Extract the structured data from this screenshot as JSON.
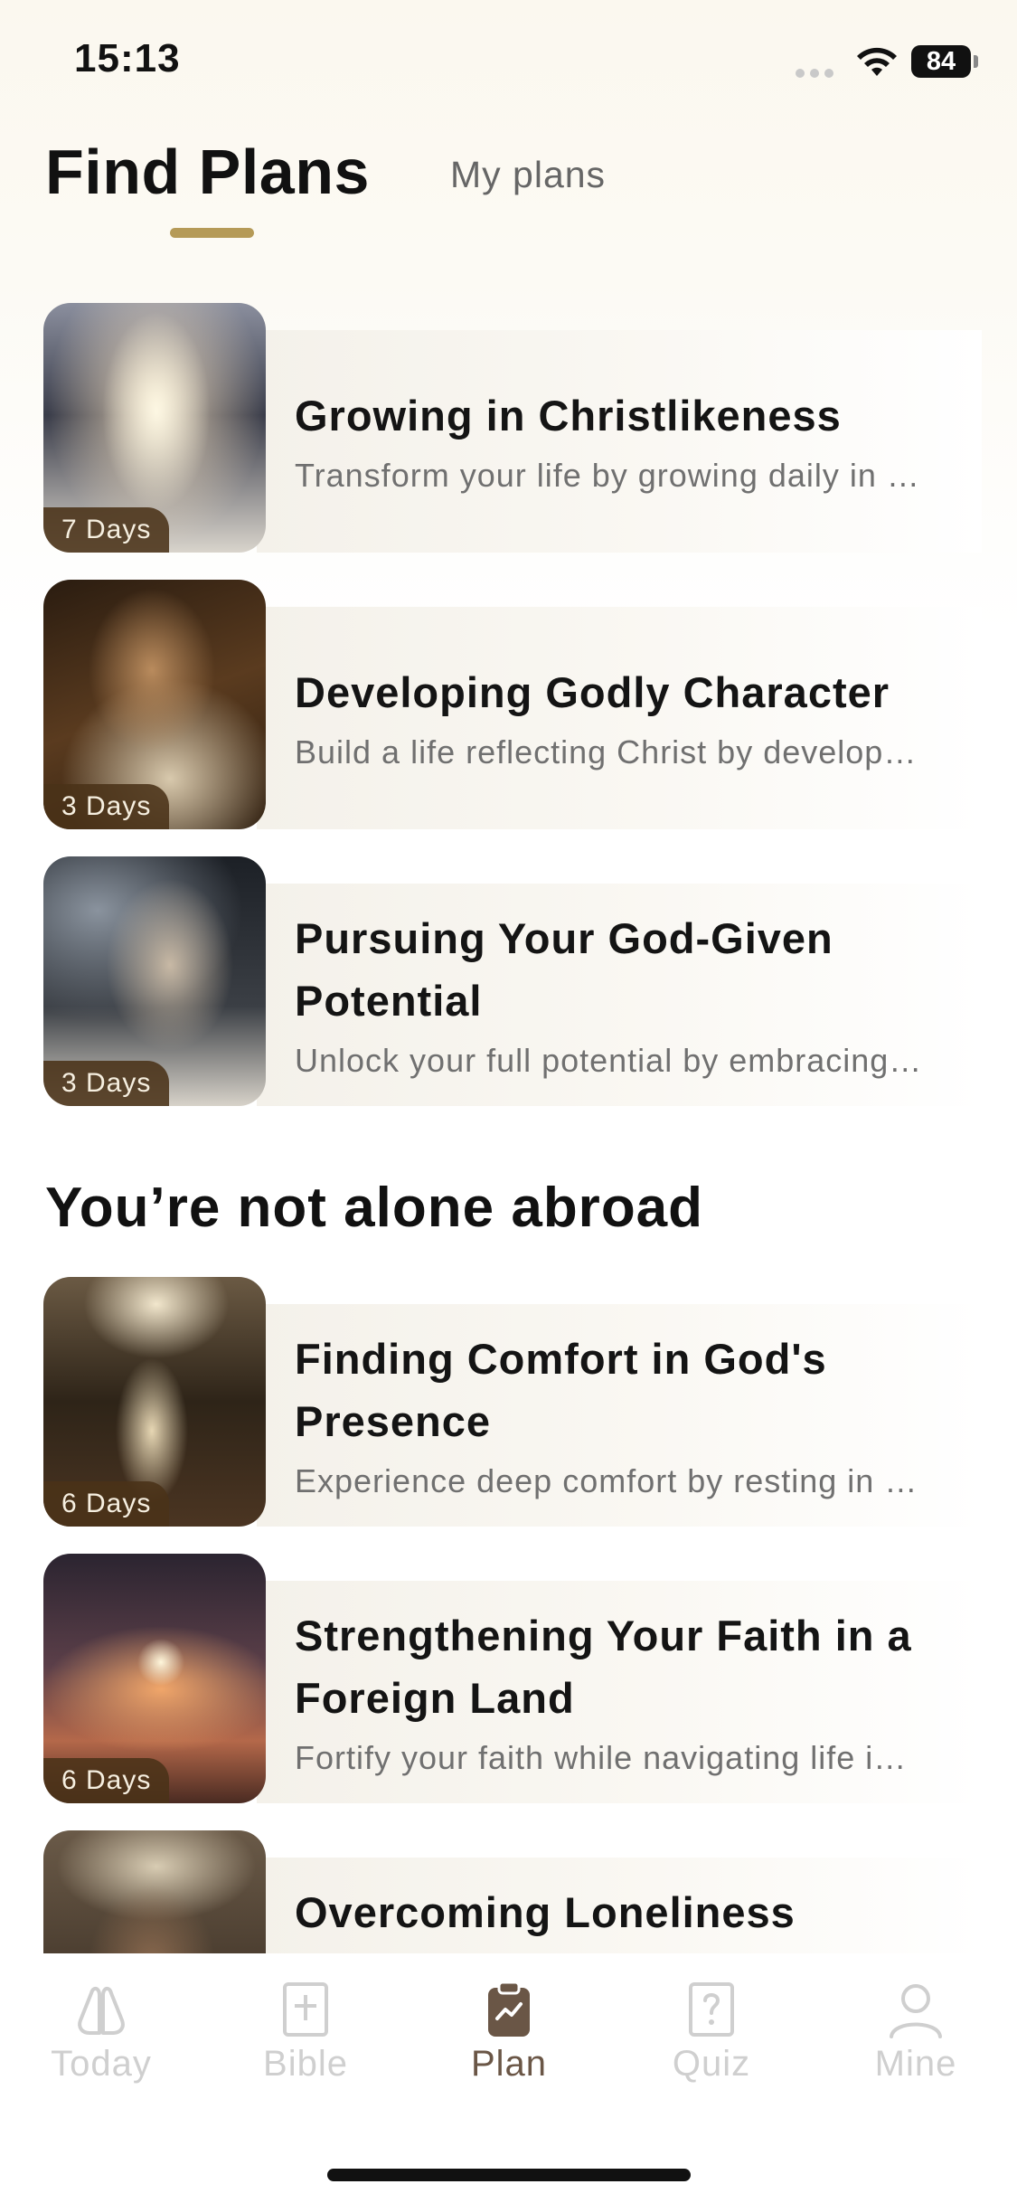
{
  "status_bar": {
    "time": "15:13",
    "battery": "84"
  },
  "header": {
    "active_tab": "Find Plans",
    "other_tab": "My plans"
  },
  "plans": [
    {
      "title": "Growing in Christlikeness",
      "description": "Transform your life by growing daily in …",
      "days": "7 Days"
    },
    {
      "title": "Developing Godly Character",
      "description": "Build a life reflecting Christ by develop…",
      "days": "3 Days"
    },
    {
      "title": "Pursuing Your God-Given Potential",
      "description": "Unlock your full potential by embracing…",
      "days": "3 Days"
    }
  ],
  "section": {
    "title": "You’re not alone abroad",
    "plans": [
      {
        "title": "Finding Comfort in God's Presence",
        "description": "Experience deep comfort by resting in …",
        "days": "6 Days"
      },
      {
        "title": "Strengthening Your Faith in a Foreign Land",
        "description": "Fortify your faith while navigating life i…",
        "days": "6 Days"
      },
      {
        "title": "Overcoming Loneliness"
      }
    ]
  },
  "nav": [
    {
      "label": "Today",
      "icon": "praying-hands-icon"
    },
    {
      "label": "Bible",
      "icon": "bible-icon"
    },
    {
      "label": "Plan",
      "icon": "plan-clipboard-icon",
      "active": true
    },
    {
      "label": "Quiz",
      "icon": "quiz-icon"
    },
    {
      "label": "Mine",
      "icon": "person-icon"
    }
  ],
  "colors": {
    "accent": "#b59a57",
    "active_nav": "#6a5646",
    "inactive_nav": "#cfcfcf",
    "badge": "#4a3218"
  }
}
